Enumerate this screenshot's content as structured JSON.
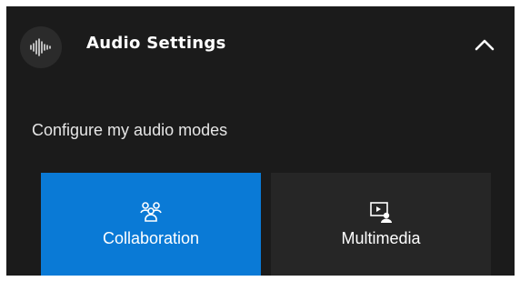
{
  "header": {
    "title": "Audio Settings",
    "icon": "waveform-icon",
    "toggle_icon": "chevron-up-icon"
  },
  "subtitle": "Configure my audio modes",
  "modes": [
    {
      "label": "Collaboration",
      "icon": "people-group-icon",
      "selected": true
    },
    {
      "label": "Multimedia",
      "icon": "media-presenter-icon",
      "selected": false
    }
  ],
  "colors": {
    "background": "#1b1b1b",
    "selected": "#0a7ad6",
    "unselected": "#262626",
    "text": "#ffffff"
  }
}
